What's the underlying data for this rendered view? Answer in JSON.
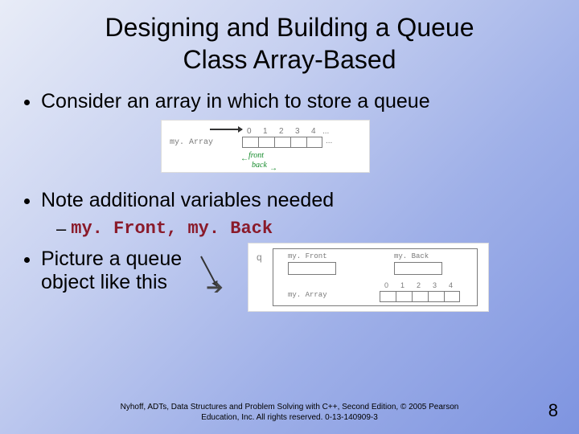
{
  "title_line1": "Designing and Building a Queue",
  "title_line2": "Class   Array-Based",
  "bullets": {
    "b1": "Consider an array in which to store a queue",
    "b2": "Note additional variables needed",
    "b2_sub": "my. Front, my. Back",
    "b3a": "Picture a queue",
    "b3b": "object like this"
  },
  "fig1": {
    "myArray": "my. Array",
    "indices": [
      "0",
      "1",
      "2",
      "3",
      "4",
      "...",
      "..."
    ],
    "front": "front",
    "back": "back"
  },
  "fig2": {
    "q": "q",
    "myFront": "my. Front",
    "myBack": "my. Back",
    "myArray": "my. Array",
    "indices": [
      "0",
      "1",
      "2",
      "3",
      "4"
    ]
  },
  "footer": {
    "line1": "Nyhoff, ADTs, Data Structures and Problem Solving with C++, Second Edition, © 2005 Pearson",
    "line2": "Education, Inc. All rights reserved. 0-13-140909-3"
  },
  "page_number": "8"
}
